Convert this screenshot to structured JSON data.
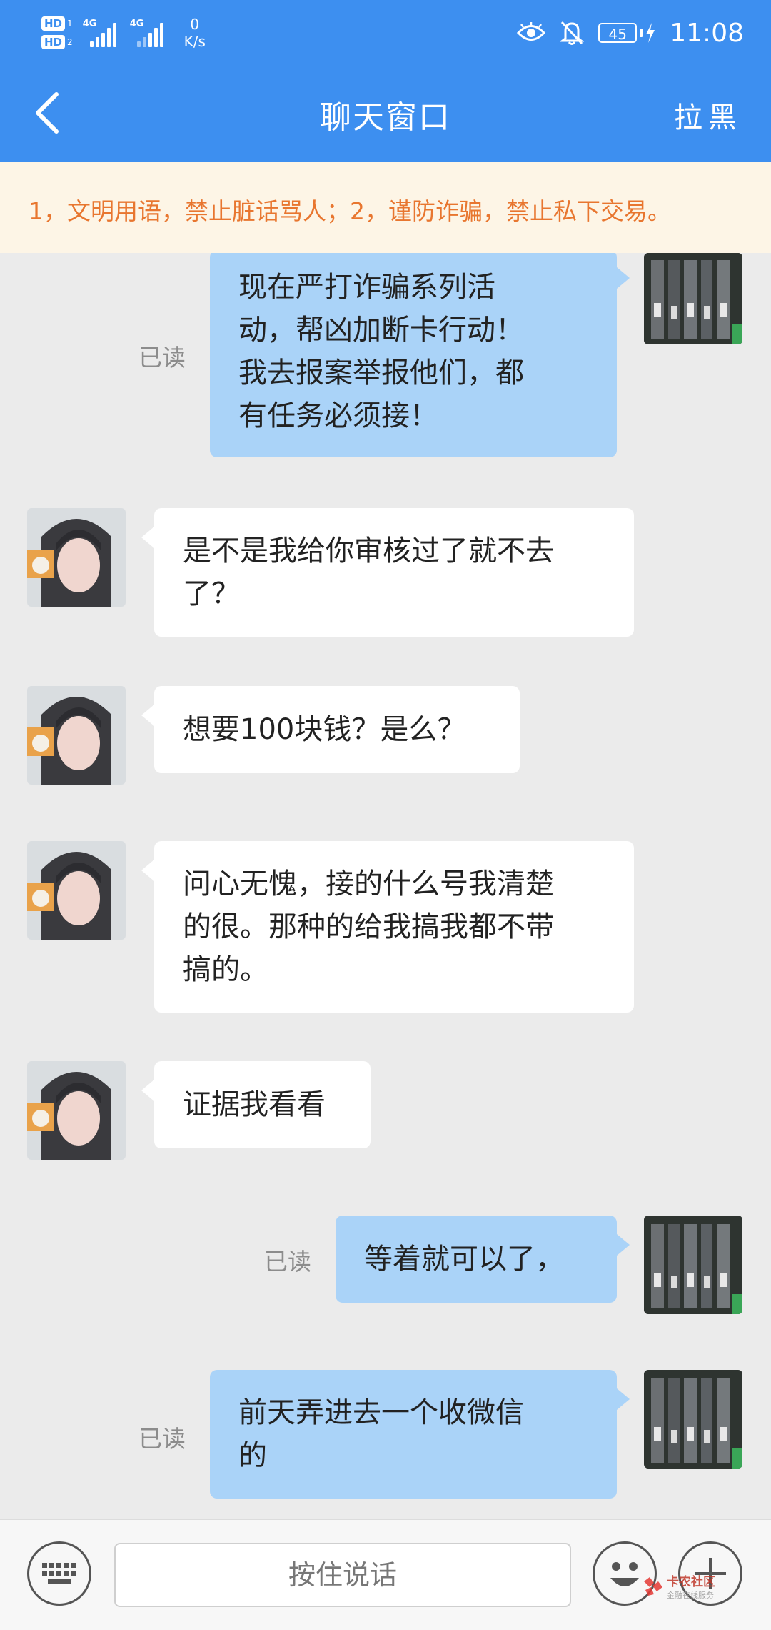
{
  "status_bar": {
    "sim1": "HD",
    "sim1_num": "1",
    "sim2": "HD",
    "sim2_num": "2",
    "net1": "4G",
    "net2": "4G",
    "net_speed_value": "0",
    "net_speed_unit": "K/s",
    "battery": "45",
    "time": "11:08",
    "icons": [
      "eye-icon",
      "bell-off-icon",
      "charging-icon"
    ]
  },
  "header": {
    "title": "聊天窗口",
    "right_action": "拉黑",
    "back_icon": "chevron-left-icon",
    "color": "#3d8ff0"
  },
  "notice": {
    "text": "1，文明用语，禁止脏话骂人；2，谨防诈骗，禁止私下交易。",
    "color": "#e8762f"
  },
  "messages": [
    {
      "side": "out",
      "lines": [
        "现在严打诈骗系列活",
        "动，帮凶加断卡行动！",
        "我去报案举报他们，都",
        "有任务必须接！"
      ],
      "status": "已读"
    },
    {
      "side": "in",
      "lines": [
        "是不是我给你审核过了就不去",
        "了？"
      ]
    },
    {
      "side": "in",
      "lines": [
        "想要100块钱？是么？"
      ]
    },
    {
      "side": "in",
      "lines": [
        "问心无愧，接的什么号我清楚",
        "的很。那种的给我搞我都不带",
        "搞的。"
      ]
    },
    {
      "side": "in",
      "lines": [
        "证据我看看"
      ]
    },
    {
      "side": "out",
      "lines": [
        "等着就可以了，"
      ],
      "status": "已读"
    },
    {
      "side": "out",
      "lines": [
        "前天弄进去一个收微信",
        "的"
      ],
      "status": "已读"
    }
  ],
  "input_bar": {
    "talk_label": "按住说话",
    "icons": [
      "keyboard-icon",
      "emoji-icon",
      "plus-icon"
    ]
  },
  "watermark": {
    "name": "卡农社区",
    "sub": "金融在线服务"
  },
  "colors": {
    "bubble_out": "#aad3f8",
    "bubble_in": "#ffffff",
    "chat_bg": "#ebebeb"
  }
}
